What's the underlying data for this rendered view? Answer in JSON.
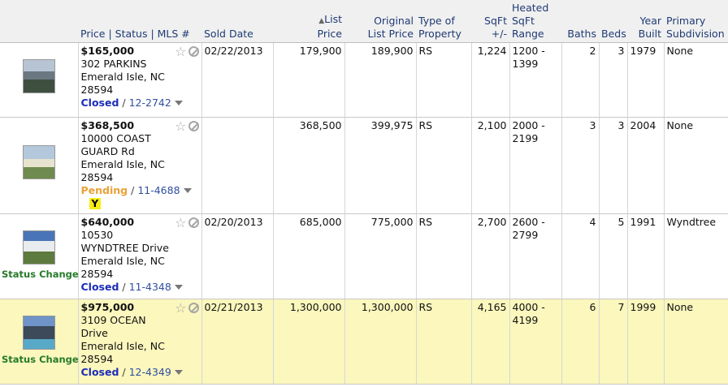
{
  "columns": {
    "info": "Price | Status | MLS #",
    "sold_date": "Sold Date",
    "list_price_l1": "List",
    "list_price_l2": "Price",
    "sort_indicator": "▲",
    "orig_price_l1": "Original",
    "orig_price_l2": "List Price",
    "type_l1": "Type of",
    "type_l2": "Property",
    "sqft_l1": "SqFt",
    "sqft_l2": "+/-",
    "heated_l0": "Heated",
    "heated_l1": "SqFt",
    "heated_l2": "Range",
    "baths": "Baths",
    "beds": "Beds",
    "year_l1": "Year",
    "year_l2": "Built",
    "subdiv_l1": "Primary",
    "subdiv_l2": "Subdivision"
  },
  "rows": [
    {
      "highlighted": false,
      "photo_icon": "house-photo",
      "status_change": "",
      "price": "$165,000",
      "address": [
        "302 PARKINS",
        "Emerald Isle, NC",
        "28594"
      ],
      "status": "Closed",
      "mls": "12-2742",
      "badge": "",
      "sold_date": "02/22/2013",
      "list_price": "179,900",
      "original_list_price": "189,900",
      "type": "RS",
      "sqft": "1,224",
      "heated_range": [
        "1200 -",
        "1399"
      ],
      "baths": "2",
      "beds": "3",
      "year_built": "1979",
      "subdivision": "None"
    },
    {
      "highlighted": false,
      "photo_icon": "house-photo",
      "status_change": "",
      "price": "$368,500",
      "address": [
        "10000 COAST",
        "GUARD Rd",
        "Emerald Isle, NC",
        "28594"
      ],
      "status": "Pending",
      "mls": "11-4688",
      "badge": "Y",
      "sold_date": "",
      "list_price": "368,500",
      "original_list_price": "399,975",
      "type": "RS",
      "sqft": "2,100",
      "heated_range": [
        "2000 -",
        "2199"
      ],
      "baths": "3",
      "beds": "3",
      "year_built": "2004",
      "subdivision": "None"
    },
    {
      "highlighted": false,
      "photo_icon": "house-photo",
      "status_change": "Status Change",
      "price": "$640,000",
      "address": [
        "10530",
        "WYNDTREE Drive",
        "Emerald Isle, NC",
        "28594"
      ],
      "status": "Closed",
      "mls": "11-4348",
      "badge": "",
      "sold_date": "02/20/2013",
      "list_price": "685,000",
      "original_list_price": "775,000",
      "type": "RS",
      "sqft": "2,700",
      "heated_range": [
        "2600 -",
        "2799"
      ],
      "baths": "4",
      "beds": "5",
      "year_built": "1991",
      "subdivision": "Wyndtree"
    },
    {
      "highlighted": true,
      "photo_icon": "house-photo",
      "status_change": "Status Change",
      "price": "$975,000",
      "address": [
        "3109 OCEAN",
        "Drive",
        "Emerald Isle, NC",
        "28594"
      ],
      "status": "Closed",
      "mls": "12-4349",
      "badge": "",
      "sold_date": "02/21/2013",
      "list_price": "1,300,000",
      "original_list_price": "1,300,000",
      "type": "RS",
      "sqft": "4,165",
      "heated_range": [
        "4000 -",
        "4199"
      ],
      "baths": "6",
      "beds": "7",
      "year_built": "1999",
      "subdivision": "None"
    }
  ]
}
